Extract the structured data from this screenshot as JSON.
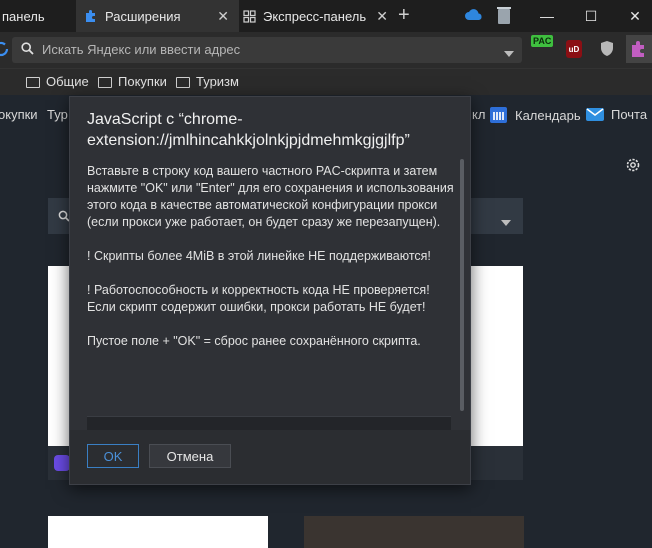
{
  "tabs": [
    {
      "label": "панель"
    },
    {
      "label": "Расширения"
    },
    {
      "label": "Экспресс-панель"
    }
  ],
  "address_bar": {
    "placeholder": "Искать Яндекс или ввести адрес"
  },
  "extensions": {
    "pac_label": "PAC",
    "ublock_label": "uD"
  },
  "bookmarks": [
    {
      "label": "Общие"
    },
    {
      "label": "Покупки"
    },
    {
      "label": "Туризм"
    }
  ],
  "express_row": {
    "left_1": "окупки",
    "left_2": "Тур",
    "right_partial": "кл",
    "calendar": "Календарь",
    "mail": "Почта"
  },
  "dialog": {
    "title": "JavaScript с “chrome-extension://jmlhincahkkjolnkjpjdmehmkgjgjlfp”",
    "lines": [
      "Вставьте в строку код вашего частного PAC-скрипта и затем нажмите \"OK\" или \"Enter\" для его сохранения и использования",
      "этого кода в качестве автоматической конфигурации прокси",
      "(если прокси уже работает, он будет сразу же перезапущен).",
      "",
      "! Скрипты более 4MiB в этой линейке НЕ поддерживаются!",
      "",
      "! Работоспособность и корректность кода НЕ проверяется!",
      "Если скрипт содержит ошибки, прокси работать НЕ будет!",
      "",
      "Пустое поле + \"OK\" = сброс ранее сохранённого скрипта."
    ],
    "ok_label": "OK",
    "cancel_label": "Отмена"
  },
  "colors": {
    "accent": "#3a7fc4",
    "dialog_bg": "#2f3136",
    "page_bg": "#20262e"
  }
}
